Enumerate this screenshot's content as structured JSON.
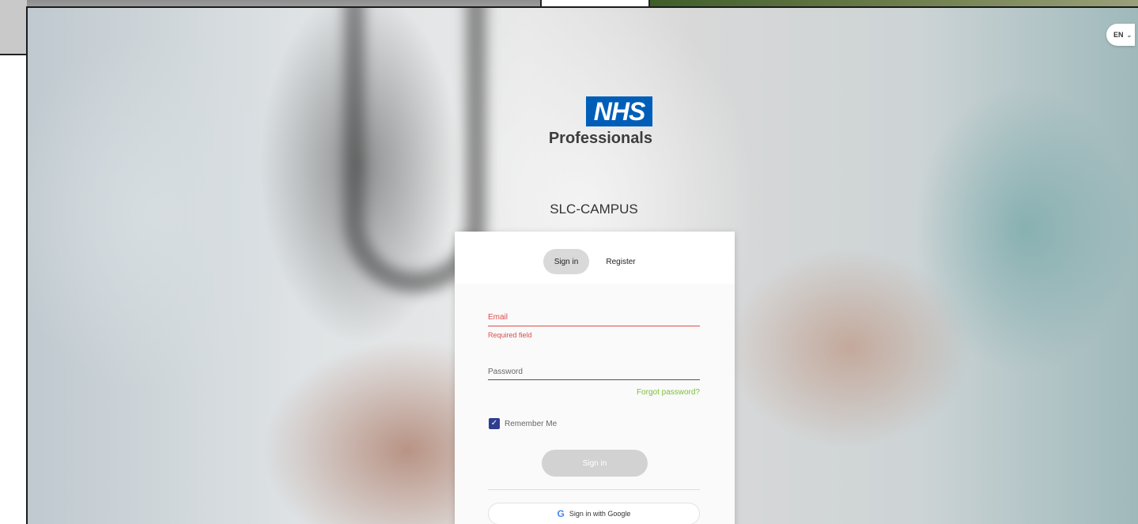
{
  "header": {
    "language": "EN"
  },
  "logo": {
    "brand": "NHS",
    "sub": "Professionals"
  },
  "campus_name": "SLC-CAMPUS",
  "tabs": {
    "signin": "Sign in",
    "register": "Register"
  },
  "form": {
    "email_label": "Email",
    "email_error": "Required field",
    "password_label": "Password",
    "forgot": "Forgot password?",
    "remember": "Remember Me",
    "remember_checked": true,
    "signin_button": "Sign in",
    "google_button": "Sign in with Google"
  },
  "colors": {
    "nhs_blue": "#005eb8",
    "error_red": "#e04b4b",
    "link_green": "#7cbf3a",
    "checkbox_navy": "#2e3d8f"
  }
}
